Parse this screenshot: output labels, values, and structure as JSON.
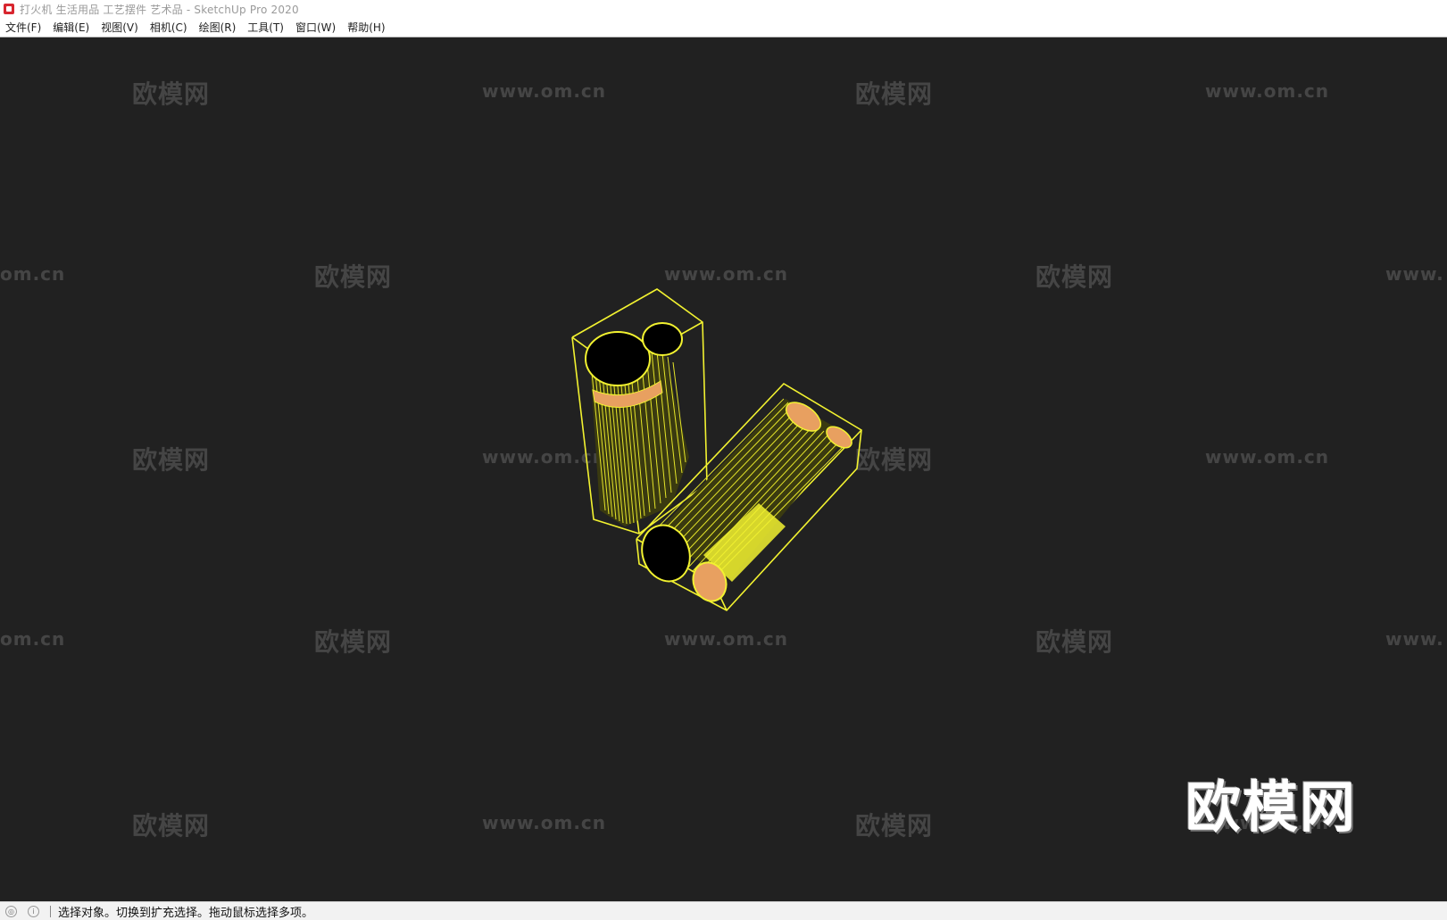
{
  "window": {
    "title": "打火机 生活用品 工艺摆件 艺术品 - SketchUp Pro 2020",
    "app_icon": "sketchup-icon"
  },
  "menu": {
    "items": [
      {
        "label": "文件(F)"
      },
      {
        "label": "编辑(E)"
      },
      {
        "label": "视图(V)"
      },
      {
        "label": "相机(C)"
      },
      {
        "label": "绘图(R)"
      },
      {
        "label": "工具(T)"
      },
      {
        "label": "窗口(W)"
      },
      {
        "label": "帮助(H)"
      }
    ]
  },
  "viewport": {
    "background": "#212121",
    "selection_color": "#f2f230",
    "accent_color": "#e8a060"
  },
  "watermark": {
    "cn_text": "欧模网",
    "url_text": "www.om.cn",
    "url_partial_left": "om.cn",
    "url_partial_right": "www.",
    "logo_text": "欧模网"
  },
  "status": {
    "icons": [
      "geo-location-icon",
      "info-icon"
    ],
    "text": "选择对象。切换到扩充选择。拖动鼠标选择多项。"
  }
}
